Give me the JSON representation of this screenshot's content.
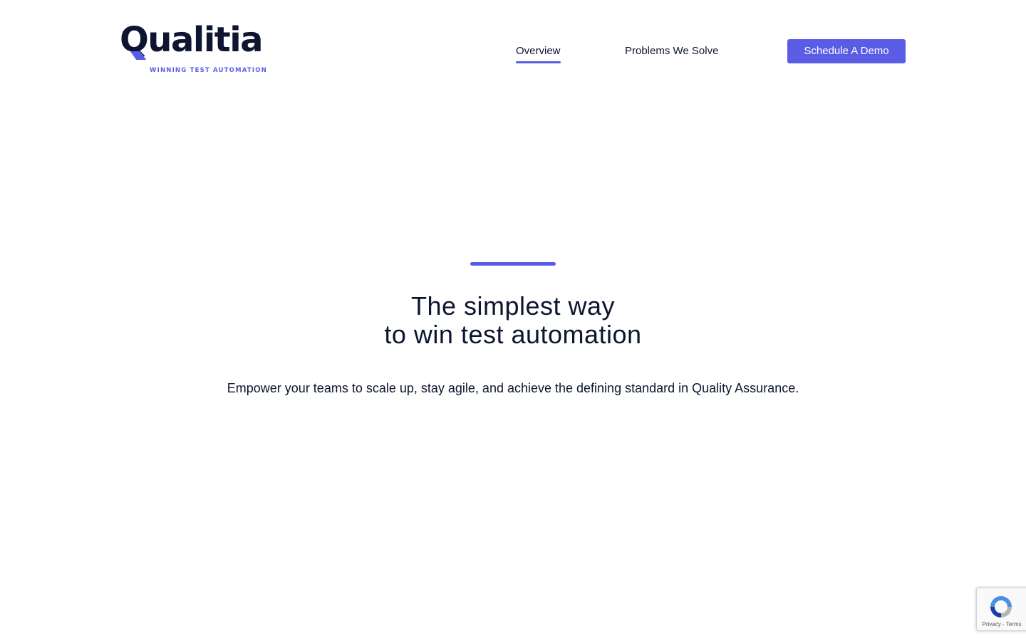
{
  "brand": {
    "name": "Qualitia",
    "tagline": "WINNING TEST AUTOMATION",
    "accent_color": "#5b5ce6",
    "text_color": "#0d1530"
  },
  "nav": {
    "items": [
      {
        "label": "Overview",
        "active": true
      },
      {
        "label": "Problems We Solve",
        "active": false
      }
    ],
    "cta_label": "Schedule A Demo"
  },
  "hero": {
    "title_line1": "The simplest way",
    "title_line2": "to win test automation",
    "subtitle": "Empower your teams to scale up, stay agile, and achieve the defining standard in Quality Assurance."
  },
  "recaptcha": {
    "icon": "recaptcha-logo",
    "privacy_label": "Privacy",
    "separator": " - ",
    "terms_label": "Terms"
  }
}
